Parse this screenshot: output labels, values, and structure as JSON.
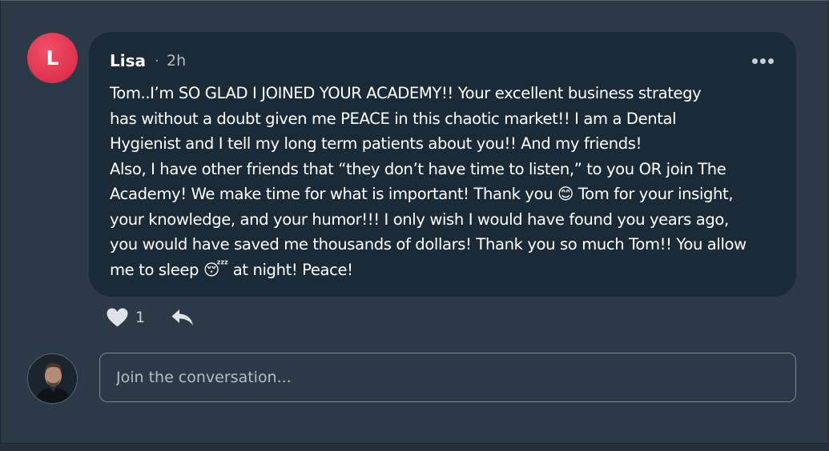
{
  "post": {
    "avatar_letter": "L",
    "author": "Lisa",
    "separator": "·",
    "time": "2h",
    "message": "Tom..I’m SO GLAD I JOINED YOUR ACADEMY!! Your excellent business strategy\nhas without a doubt given me PEACE in this chaotic market!! I am a Dental\nHygienist and I tell my long term patients about you!!  And my friends!\nAlso, I have other friends that “they don’t have time to listen,”  to you OR join The\nAcademy! We make time for what is important! Thank you 😊 Tom for your insight,\nyour knowledge, and your humor!!! I only wish I would have found you years ago,\nyou would have saved me thousands of dollars! Thank you so much Tom!! You allow\nme to sleep 😴 at night! Peace!",
    "like_count": "1"
  },
  "composer": {
    "placeholder": "Join the conversation..."
  },
  "icons": {
    "more": "more-horizontal-icon",
    "like": "heart-icon",
    "reply": "reply-icon"
  },
  "colors": {
    "background": "#2c3a48",
    "bubble": "#1a2a36",
    "avatar_accent": "#e2324e"
  }
}
